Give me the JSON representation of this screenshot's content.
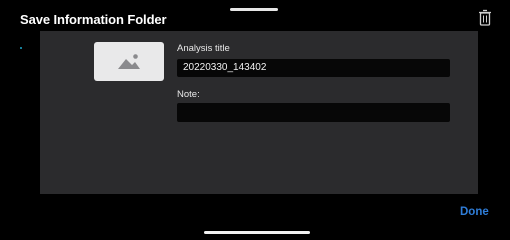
{
  "dialog": {
    "title": "Save Information Folder",
    "trash_icon": "trash-icon",
    "thumbnail_icon": "image-placeholder-icon"
  },
  "form": {
    "analysis_title_label": "Analysis title",
    "analysis_title_value": "20220330_143402",
    "note_label": "Note:",
    "note_value": ""
  },
  "footer": {
    "done_label": "Done"
  },
  "colors": {
    "background": "#000000",
    "panel": "#2b2b2d",
    "field": "#070707",
    "accent": "#2f7dd8"
  }
}
